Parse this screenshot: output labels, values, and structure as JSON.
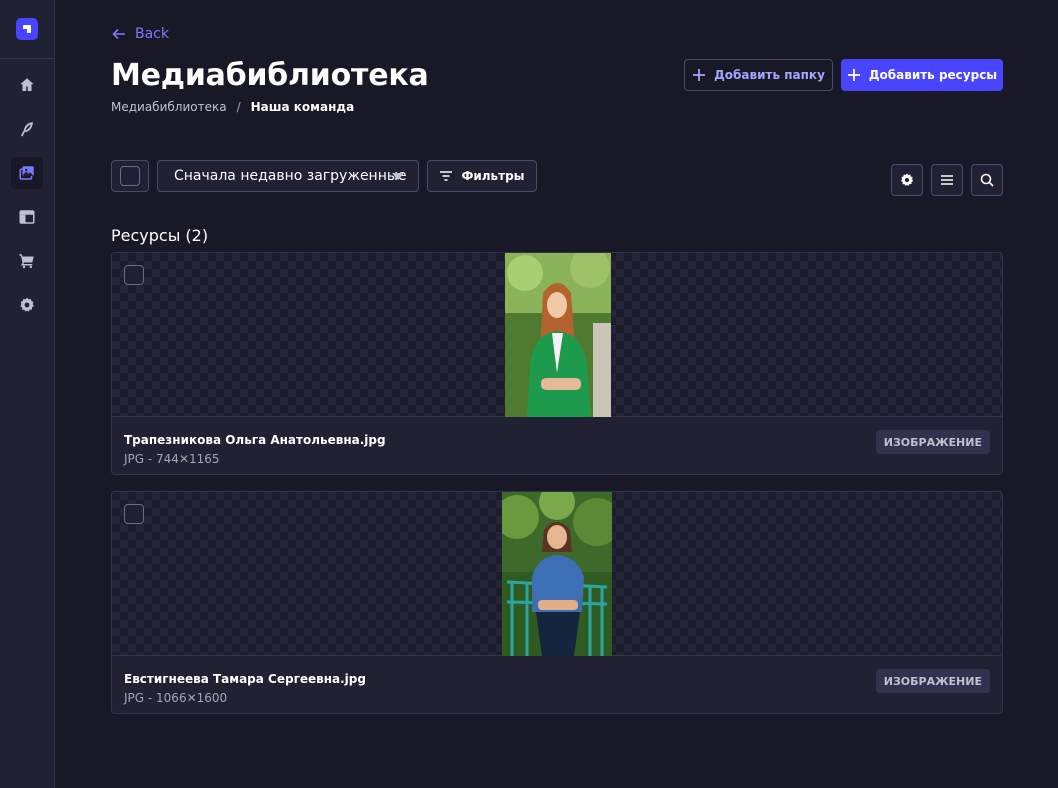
{
  "nav": {
    "items": [
      {
        "name": "home-icon"
      },
      {
        "name": "feather-icon"
      },
      {
        "name": "media-library-icon"
      },
      {
        "name": "layout-icon"
      },
      {
        "name": "cart-icon"
      },
      {
        "name": "gear-icon"
      }
    ],
    "active": "media-library-icon"
  },
  "header": {
    "back_label": "Back",
    "title": "Медиабиблиотека",
    "breadcrumb": {
      "root": "Медиабиблиотека",
      "separator": "/",
      "current": "Наша команда"
    },
    "add_folder_label": "Добавить папку",
    "add_assets_label": "Добавить ресурсы"
  },
  "toolbar": {
    "sort_value": "Сначала недавно загруженные",
    "filters_label": "Фильтры"
  },
  "assets": {
    "section_title": "Ресурсы (2)",
    "items": [
      {
        "name": "Трапезникова Ольга Анатольевна.jpg",
        "meta": "JPG - 744✕1165",
        "type_badge": "ИЗОБРАЖЕНИЕ"
      },
      {
        "name": "Евстигнеева Тамара Сергеевна.jpg",
        "meta": "JPG - 1066✕1600",
        "type_badge": "ИЗОБРАЖЕНИЕ"
      }
    ]
  },
  "colors": {
    "accent": "#4945ff",
    "background": "#181826",
    "panel": "#212134"
  }
}
